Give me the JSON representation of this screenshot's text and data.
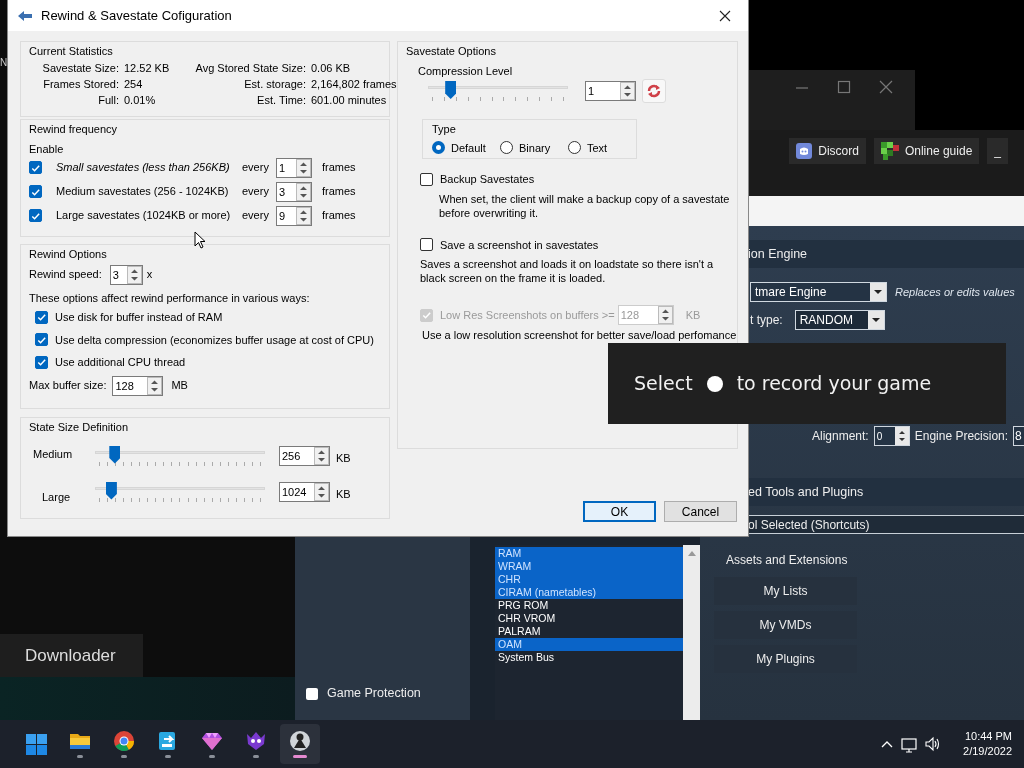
{
  "left_window": {
    "edge_text": "N",
    "tile": "Downloader"
  },
  "app": {
    "toolbar_buttons": [
      {
        "label": "Discord",
        "kind": "discord"
      },
      {
        "label": "Online guide",
        "kind": "guide"
      },
      {
        "label": "_",
        "kind": "plain"
      }
    ],
    "engine": {
      "title": "ion Engine",
      "engine_value": "tmare Engine",
      "hint": "Replaces or edits values",
      "type_label": "t type:",
      "type_value": "RANDOM",
      "alignment_label": "Alignment:",
      "alignment_value": "0",
      "precision_label": "Engine Precision:",
      "precision_value": "8"
    },
    "tools_title": "ed Tools and Plugins",
    "shortcuts_label": "ol Selected (Shortcuts)",
    "memory_list": [
      {
        "label": "RAM",
        "selected": true
      },
      {
        "label": "WRAM",
        "selected": true
      },
      {
        "label": "CHR",
        "selected": true
      },
      {
        "label": "CIRAM (nametables)",
        "selected": true
      },
      {
        "label": "PRG ROM",
        "selected": false
      },
      {
        "label": "CHR VROM",
        "selected": false
      },
      {
        "label": "PALRAM",
        "selected": false
      },
      {
        "label": "OAM",
        "selected": true
      },
      {
        "label": "System Bus",
        "selected": false
      }
    ],
    "game_protection": {
      "label": "Game Protection",
      "checked": false
    },
    "assets": {
      "title": "Assets and Extensions",
      "buttons": [
        "My Lists",
        "My VMDs",
        "My Plugins"
      ]
    }
  },
  "dialog": {
    "title": "Rewind & Savestate Cofiguration",
    "stats": {
      "title": "Current Statistics",
      "rows": [
        {
          "label": "Savestate Size:",
          "value": "12.52 KB",
          "label2": "Avg Stored State Size:",
          "value2": "0.06 KB"
        },
        {
          "label": "Frames Stored:",
          "value": "254",
          "label2": "Est. storage:",
          "value2": "2,164,802 frames"
        },
        {
          "label": "Full:",
          "value": "0.01%",
          "label2": "Est. Time:",
          "value2": "601.00 minutes"
        }
      ]
    },
    "rewind_frequency": {
      "title": "Rewind frequency",
      "enable_label": "Enable",
      "rows": [
        {
          "label": "Small savestates (less than 256KB)",
          "italic": true,
          "checked": true,
          "every": "every",
          "value": "1",
          "unit": "frames"
        },
        {
          "label": "Medium savestates (256 - 1024KB)",
          "italic": false,
          "checked": true,
          "every": "every",
          "value": "3",
          "unit": "frames"
        },
        {
          "label": "Large savestates (1024KB or more)",
          "italic": false,
          "checked": true,
          "every": "every",
          "value": "9",
          "unit": "frames"
        }
      ]
    },
    "rewind_options": {
      "title": "Rewind Options",
      "speed_label": "Rewind speed:",
      "speed_value": "3",
      "speed_unit": "x",
      "note": "These options affect rewind performance in various ways:",
      "options": [
        {
          "label": "Use disk for buffer instead of RAM",
          "checked": true
        },
        {
          "label": "Use delta compression (economizes buffer usage at cost of CPU)",
          "checked": true
        },
        {
          "label": "Use additional CPU thread",
          "checked": true
        }
      ],
      "buffer_label": "Max buffer size:",
      "buffer_value": "128",
      "buffer_unit": "MB"
    },
    "state_size": {
      "title": "State Size Definition",
      "rows": [
        {
          "label": "Medium",
          "level": 0.09,
          "value": "256",
          "unit": "KB"
        },
        {
          "label": "Large",
          "level": 0.07,
          "value": "1024",
          "unit": "KB"
        }
      ]
    },
    "savestate_options": {
      "title": "Savestate Options",
      "compression": {
        "label": "Compression Level",
        "level": 0.13,
        "value": "1"
      },
      "type": {
        "title": "Type",
        "options": [
          {
            "label": "Default",
            "selected": true
          },
          {
            "label": "Binary",
            "selected": false
          },
          {
            "label": "Text",
            "selected": false
          }
        ]
      },
      "backup": {
        "label": "Backup Savestates",
        "checked": false,
        "description": "When set, the client will make a backup copy of a savestate before overwriting it."
      },
      "screenshot": {
        "label": "Save a screenshot in savestates",
        "checked": false,
        "description": "Saves a screenshot and loads it on loadstate so there isn't a black screen on the frame it is loaded."
      },
      "low_res": {
        "label": "Low Res Screenshots on buffers >=",
        "checked": true,
        "disabled": true,
        "value": "128",
        "unit": "KB",
        "description": "Use a low resolution screenshot for better save/load perfomance"
      }
    },
    "buttons": [
      {
        "label": "OK",
        "default": true
      },
      {
        "label": "Cancel",
        "default": false
      }
    ]
  },
  "recording_hint": {
    "before": "Select",
    "after": "to record your game"
  },
  "taskbar": {
    "apps": [
      {
        "kind": "folder",
        "selected": false
      },
      {
        "kind": "chrome",
        "selected": false
      },
      {
        "kind": "share",
        "selected": false
      },
      {
        "kind": "gem",
        "selected": false
      },
      {
        "kind": "monster",
        "selected": false
      },
      {
        "kind": "spy",
        "selected": true
      }
    ],
    "time": "10:44 PM",
    "date": "2/19/2022"
  }
}
